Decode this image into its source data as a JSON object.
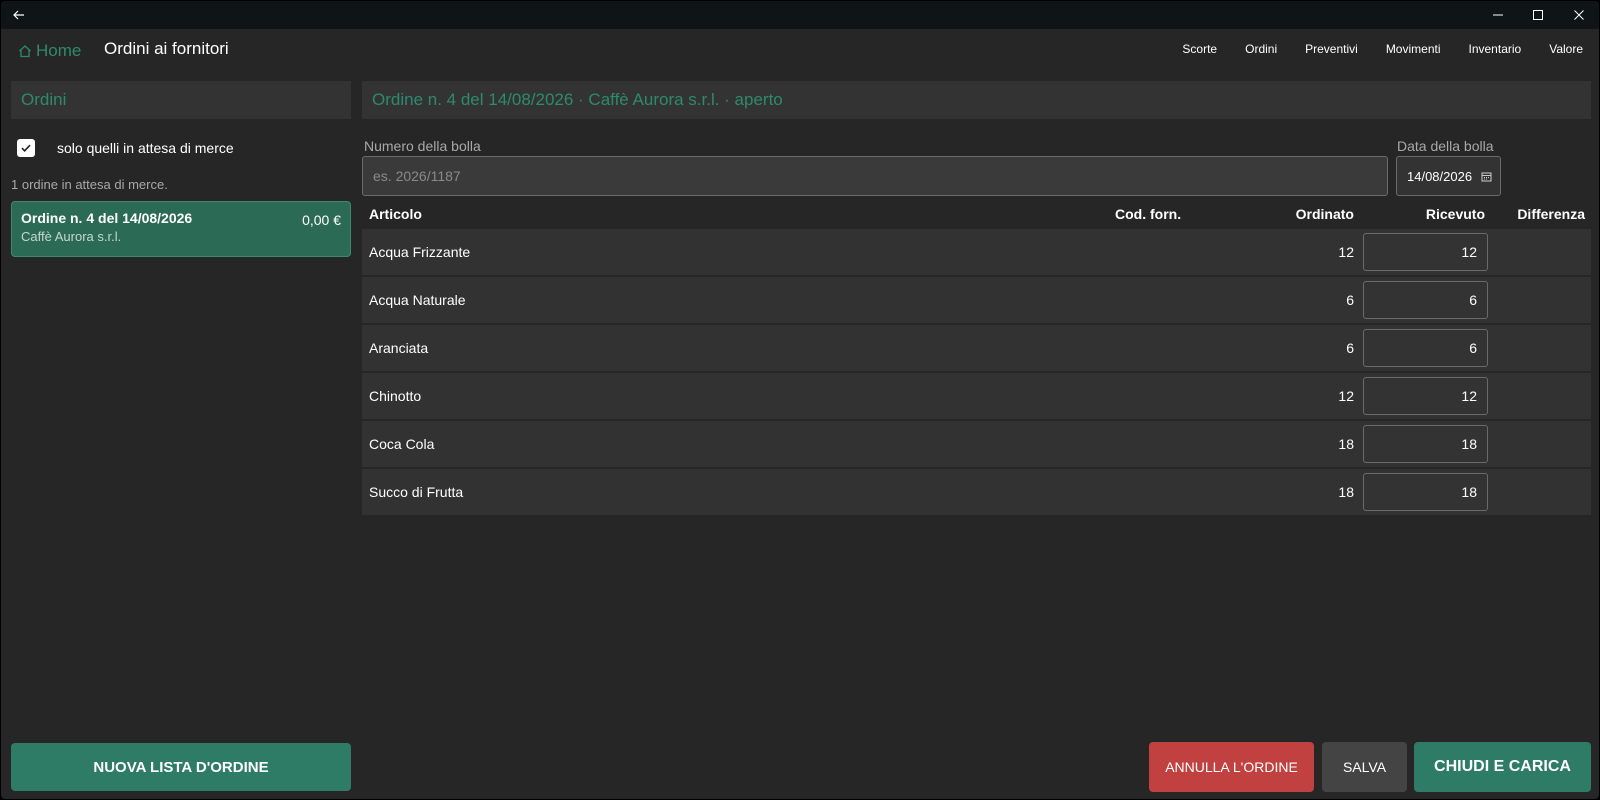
{
  "nav": {
    "home_label": "Home",
    "page_title": "Ordini ai fornitori",
    "links": [
      "Scorte",
      "Ordini",
      "Preventivi",
      "Movimenti",
      "Inventario",
      "Valore"
    ]
  },
  "left": {
    "header": "Ordini",
    "filter_label": "solo quelli in attesa di merce",
    "filter_checked": true,
    "count_text": "1 ordine in attesa di merce.",
    "order": {
      "title": "Ordine n. 4 del 14/08/2026",
      "total": "0,00 €",
      "supplier": "Caffè Aurora s.r.l."
    },
    "new_button": "NUOVA LISTA D'ORDINE"
  },
  "right": {
    "header": "Ordine n. 4 del 14/08/2026 · Caffè Aurora s.r.l. · aperto",
    "bolla_label": "Numero della bolla",
    "bolla_placeholder": "es. 2026/1187",
    "bolla_value": "",
    "date_label": "Data della bolla",
    "date_value": "14/08/2026"
  },
  "table": {
    "headers": {
      "articolo": "Articolo",
      "cod_forn": "Cod. forn.",
      "ordinato": "Ordinato",
      "ricevuto": "Ricevuto",
      "differenza": "Differenza"
    },
    "rows": [
      {
        "articolo": "Acqua Frizzante",
        "cod_forn": "",
        "ordinato": "12",
        "ricevuto": "12",
        "differenza": ""
      },
      {
        "articolo": "Acqua Naturale",
        "cod_forn": "",
        "ordinato": "6",
        "ricevuto": "6",
        "differenza": ""
      },
      {
        "articolo": "Aranciata",
        "cod_forn": "",
        "ordinato": "6",
        "ricevuto": "6",
        "differenza": ""
      },
      {
        "articolo": "Chinotto",
        "cod_forn": "",
        "ordinato": "12",
        "ricevuto": "12",
        "differenza": ""
      },
      {
        "articolo": "Coca Cola",
        "cod_forn": "",
        "ordinato": "18",
        "ricevuto": "18",
        "differenza": ""
      },
      {
        "articolo": "Succo di Frutta",
        "cod_forn": "",
        "ordinato": "18",
        "ricevuto": "18",
        "differenza": ""
      }
    ]
  },
  "actions": {
    "annulla": "ANNULLA L'ORDINE",
    "salva": "SALVA",
    "chiudi": "CHIUDI E CARICA"
  },
  "colors": {
    "accent": "#2e8a6c",
    "danger": "#c0413f",
    "background": "#262626",
    "panel": "#333333"
  },
  "icons": {
    "back": "arrow-left-icon",
    "minimize": "minimize-icon",
    "maximize": "maximize-icon",
    "close": "close-icon",
    "home": "home-icon",
    "calendar": "calendar-icon",
    "check": "check-icon"
  }
}
